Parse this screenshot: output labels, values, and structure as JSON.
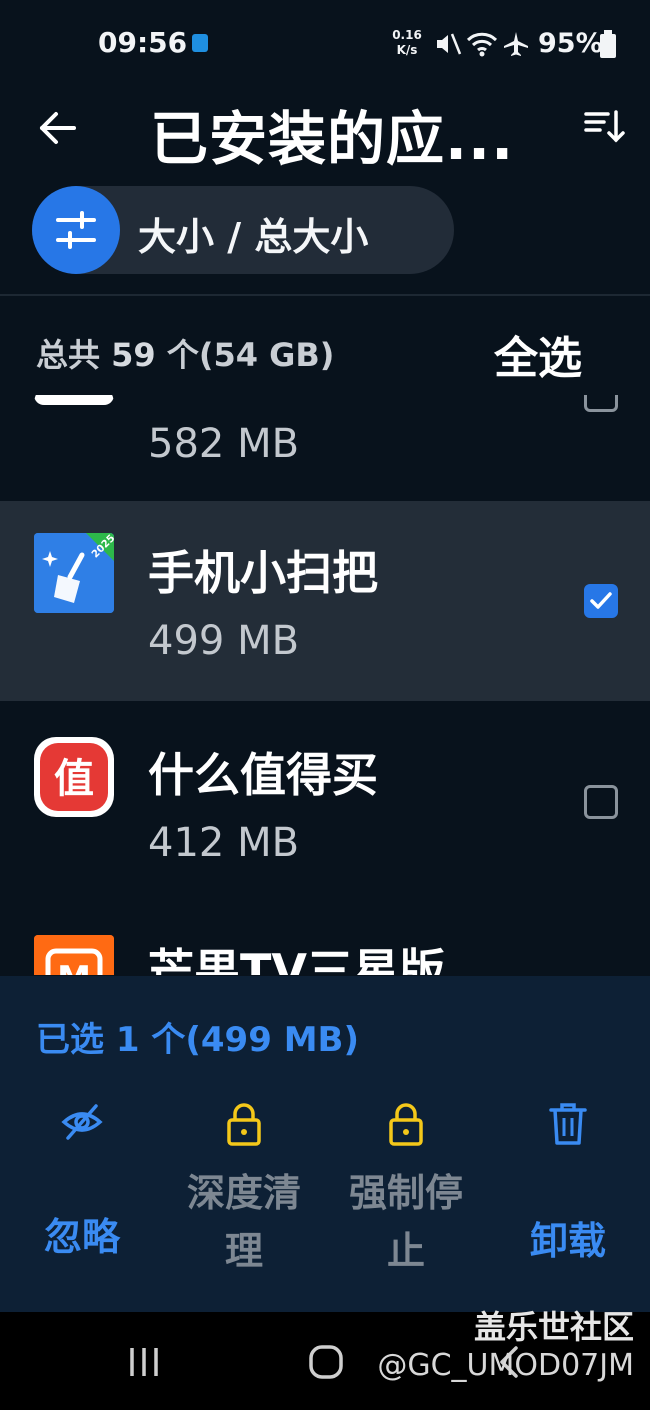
{
  "status_bar": {
    "time": "09:56",
    "net_speed_value": "0.16",
    "net_speed_unit": "K/s",
    "battery": "95%",
    "icons": [
      "notification-icon",
      "mute-icon",
      "wifi-icon",
      "airplane-icon",
      "battery-icon"
    ]
  },
  "header": {
    "title": "已安装的应...",
    "back_icon": "arrow-left-icon",
    "sort_icon": "sort-descending-icon"
  },
  "filter": {
    "icon": "sliders-icon",
    "label": "大小 / 总大小"
  },
  "summary": {
    "prefix": "总共 ",
    "count": "59",
    "suffix": " 个(54 GB)",
    "select_all": "全选"
  },
  "apps": [
    {
      "name": "",
      "size": "582 MB",
      "checked": false,
      "icon": "partial-app-icon",
      "accent": "#e8345c"
    },
    {
      "name": "手机小扫把",
      "size": "499 MB",
      "checked": true,
      "icon": "broom-cleaner-icon",
      "accent": "#2f7fe6",
      "badge": "2025"
    },
    {
      "name": "什么值得买",
      "size": "412 MB",
      "checked": false,
      "icon": "smzdm-icon",
      "accent": "#e53935",
      "glyph": "值"
    },
    {
      "name": "芒果TV三星版",
      "size": "",
      "checked": false,
      "icon": "mango-tv-icon",
      "accent": "#ff6a13",
      "glyph": "M"
    }
  ],
  "selection": {
    "prefix": "已选 ",
    "count": "1",
    "suffix": " 个(499 MB)"
  },
  "actions": [
    {
      "label": "忽略",
      "icon": "ignore-eye-icon",
      "enabled": true
    },
    {
      "label": "深度清理",
      "icon": "lock-icon",
      "enabled": false
    },
    {
      "label": "强制停止",
      "icon": "lock-icon",
      "enabled": false
    },
    {
      "label": "卸载",
      "icon": "trash-icon",
      "enabled": true
    }
  ],
  "nav": {
    "icons": [
      "recents-icon",
      "home-icon",
      "back-nav-icon"
    ]
  },
  "watermark": {
    "line1": "盖乐世社区",
    "line2": "@GC_UMOD07JM"
  },
  "colors": {
    "background": "#08121c",
    "accent_blue": "#2777e7",
    "lock_yellow": "#f4c81a",
    "panel": "#0d2035",
    "selected_row": "#232d38"
  }
}
